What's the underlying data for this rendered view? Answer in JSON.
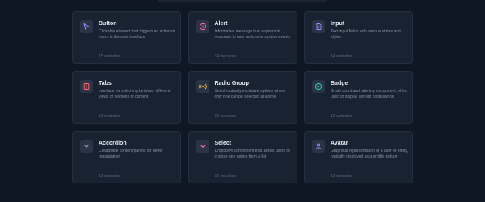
{
  "components": [
    {
      "name": "Button",
      "description": "Clickable element that triggers an action or event in the user interface",
      "count": "15 websites",
      "icon": "cursor-arrow-icon",
      "icon_color": "#8b97ff"
    },
    {
      "name": "Alert",
      "description": "Informative message that appears in response to user actions or system events",
      "count": "14 websites",
      "icon": "alert-circle-icon",
      "icon_color": "#ff6b9d"
    },
    {
      "name": "Input",
      "description": "Text input fields with various states and styles",
      "count": "14 websites",
      "icon": "document-edit-icon",
      "icon_color": "#8b97ff"
    },
    {
      "name": "Tabs",
      "description": "Interface for switching between different views or sections of content",
      "count": "13 websites",
      "icon": "tabs-icon",
      "icon_color": "#ff6b6b"
    },
    {
      "name": "Radio Group",
      "description": "Set of mutually exclusive options where only one can be selected at a time",
      "count": "12 websites",
      "icon": "radio-signal-icon",
      "icon_color": "#f5c542"
    },
    {
      "name": "Badge",
      "description": "Small count and labeling component, often used to display unread notifications",
      "count": "12 websites",
      "icon": "badge-check-icon",
      "icon_color": "#2dd4a7"
    },
    {
      "name": "Accordion",
      "description": "Collapsible content panels for better organization",
      "count": "12 websites",
      "icon": "chevron-down-icon",
      "icon_color": "#94a3b8"
    },
    {
      "name": "Select",
      "description": "Dropdown component that allows users to choose one option from a list",
      "count": "12 websites",
      "icon": "chevron-down-icon",
      "icon_color": "#ff6b9d"
    },
    {
      "name": "Avatar",
      "description": "Graphical representation of a user or entity, typically displayed as a profile picture",
      "count": "12 websites",
      "icon": "user-icon",
      "icon_color": "#8b97ff"
    }
  ]
}
